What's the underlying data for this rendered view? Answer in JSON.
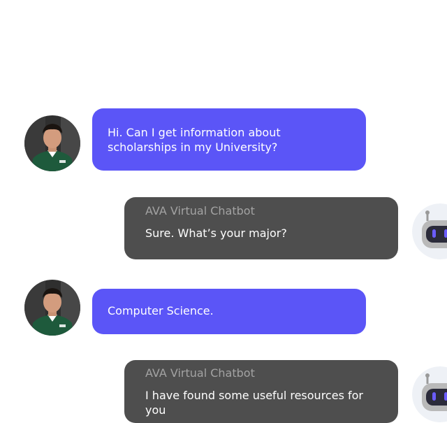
{
  "chat": {
    "messages": [
      {
        "role": "user",
        "text": "Hi. Can I get information about scholarships in my University?"
      },
      {
        "role": "bot",
        "sender": "AVA Virtual Chatbot",
        "text": "Sure. What’s your major?"
      },
      {
        "role": "user",
        "text": "Computer Science."
      },
      {
        "role": "bot",
        "sender": "AVA Virtual Chatbot",
        "text": "I have found some useful resources for you"
      }
    ]
  },
  "icons": {
    "user_avatar": "user-photo-avatar",
    "bot_avatar": "robot-avatar-icon"
  },
  "colors": {
    "user_bubble": "#5b55f7",
    "bot_bubble": "#4e4e4e",
    "sender_text": "#a3a3a3",
    "message_text": "#ffffff",
    "bot_avatar_bg": "#eef1f6",
    "robot_eye": "#6b5cff"
  }
}
